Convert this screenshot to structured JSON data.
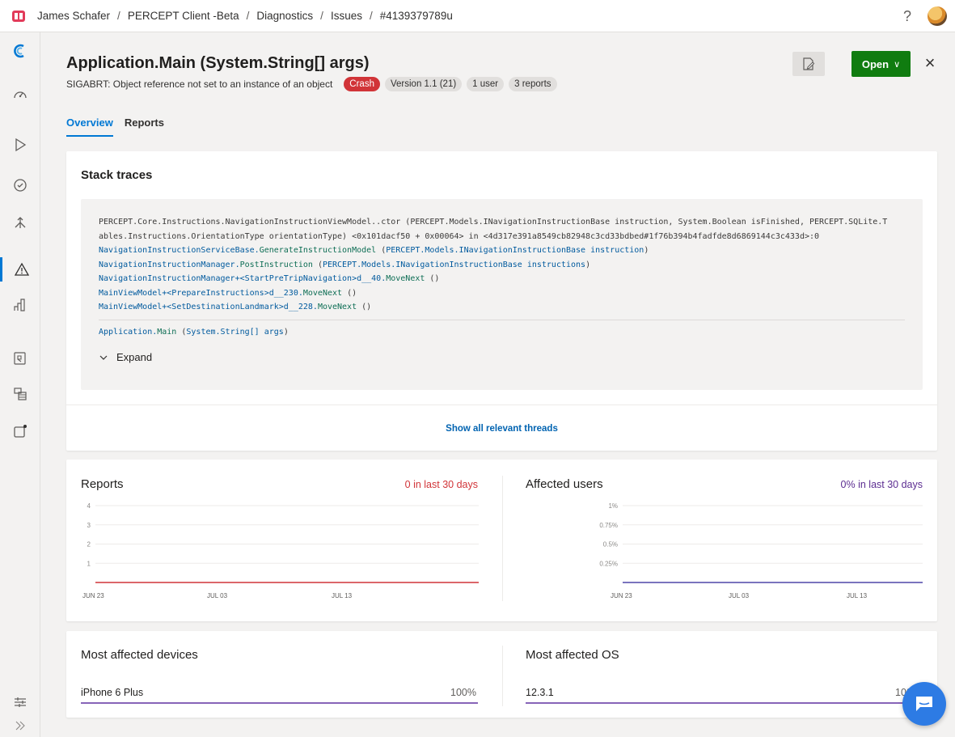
{
  "breadcrumb": [
    "James Schafer",
    "PERCEPT Client -Beta",
    "Diagnostics",
    "Issues",
    "#4139379789u"
  ],
  "topbar": {
    "help": "?"
  },
  "issue": {
    "title": "Application.Main (System.String[] args)",
    "subtitle": "SIGABRT: Object reference not set to an instance of an object",
    "badges": [
      "Crash",
      "Version 1.1 (21)",
      "1 user",
      "3 reports"
    ]
  },
  "actions": {
    "open": "Open",
    "open_caret": "∨",
    "close": "×"
  },
  "tabs": [
    "Overview",
    "Reports"
  ],
  "stack": {
    "heading": "Stack traces",
    "line1a": "PERCEPT.Core.Instructions.NavigationInstructionViewModel..ctor (PERCEPT.Models.INavigationInstructionBase instruction, System.Boolean isFinished, PERCEPT.SQLite.T",
    "line1b": "ables.Instructions.OrientationType orientationType) <0x101dacf50 + 0x00064> in <4d317e391a8549cb82948c3cd33bdbed#1f76b394b4fadfde8d6869144c3c433d>:0",
    "line2": {
      "a": "NavigationInstructionServiceBase.",
      "b": "GenerateInstructionModel",
      "c": " (",
      "d": "PERCEPT.Models.INavigationInstructionBase instruction",
      "e": ")"
    },
    "line3": {
      "a": "NavigationInstructionManager.",
      "b": "PostInstruction",
      "c": " (",
      "d": "PERCEPT.Models.INavigationInstructionBase instructions",
      "e": ")"
    },
    "line4": {
      "a": "NavigationInstructionManager+<StartPreTripNavigation>d__40.",
      "b": "MoveNext",
      "c": " ()"
    },
    "line5": {
      "a": "MainViewModel+<PrepareInstructions>d__230.",
      "b": "MoveNext",
      "c": " ()"
    },
    "line6": {
      "a": "MainViewModel+<SetDestinationLandmark>d__228.",
      "b": "MoveNext",
      "c": " ()"
    },
    "main_line": {
      "a": "Application.",
      "b": "Main",
      "c": " (",
      "d": "System.String[] args",
      "e": ")"
    },
    "expand": "Expand",
    "show_threads": "Show all relevant threads"
  },
  "reports_chart": {
    "title": "Reports",
    "summary": "0 in last 30 days",
    "summary_color": "#d13438",
    "line_color": "#d13438"
  },
  "users_chart": {
    "title": "Affected users",
    "summary": "0% in last 30 days",
    "summary_color": "#5c2d91",
    "line_color": "#4f46a8"
  },
  "chart_data": [
    {
      "type": "line",
      "title": "Reports",
      "x": [
        "JUN 23",
        "JUL 03",
        "JUL 13"
      ],
      "yticks": [
        "4",
        "3",
        "2",
        "1"
      ],
      "ylim": [
        0,
        4
      ],
      "series": [
        {
          "values": [
            0,
            0,
            0
          ]
        }
      ]
    },
    {
      "type": "line",
      "title": "Affected users",
      "x": [
        "JUN 23",
        "JUL 03",
        "JUL 13"
      ],
      "yticks": [
        "1%",
        "0.75%",
        "0.5%",
        "0.25%"
      ],
      "ylim": [
        0,
        1
      ],
      "series": [
        {
          "values": [
            0,
            0,
            0
          ]
        }
      ]
    }
  ],
  "devices": {
    "title": "Most affected devices",
    "name": "iPhone 6 Plus",
    "pct": "100%",
    "share": 1.0
  },
  "os": {
    "title": "Most affected OS",
    "name": "12.3.1",
    "pct": "100%",
    "share": 1.0
  },
  "colors": {
    "accent": "#0078d4",
    "open_button": "#107c10",
    "crash": "#d13438",
    "bar": "#8764b8"
  },
  "icons": [
    "app-logo-icon",
    "dashboard-icon",
    "build-icon",
    "test-icon",
    "distribute-icon",
    "diagnostics-icon",
    "analytics-icon",
    "data-icon",
    "settings-icon",
    "push-icon",
    "customize-icon",
    "collapse-icon"
  ]
}
